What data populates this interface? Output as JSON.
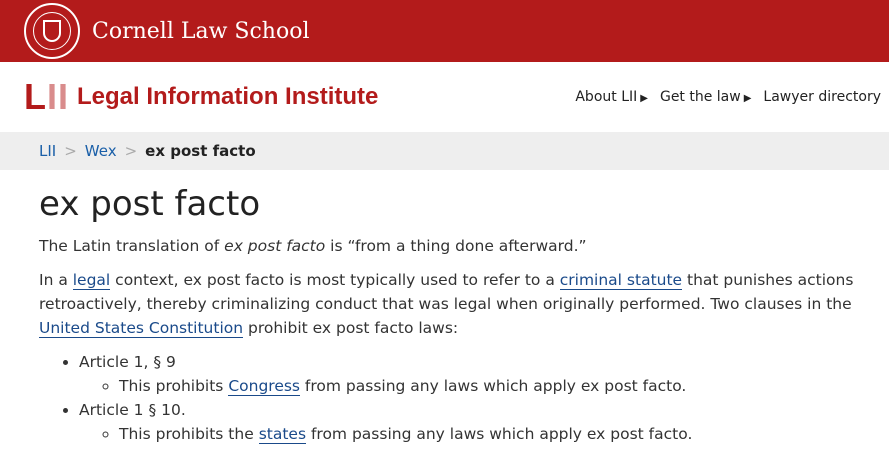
{
  "header": {
    "school": "Cornell Law School",
    "logo": "LII",
    "institute": "Legal Information Institute",
    "nav": [
      "About LII",
      "Get the law",
      "Lawyer directory"
    ]
  },
  "breadcrumb": [
    "LII",
    ">",
    "Wex",
    ">",
    "ex post facto"
  ],
  "title": "ex post facto",
  "p1": {
    "a": "The Latin translation of ",
    "em": "ex post facto",
    "b": " is “from a thing done afterward.”"
  },
  "p2": {
    "a": "In a ",
    "l1": "legal",
    "b": " context, ex post facto is most typically used to refer to a ",
    "l2": "criminal statute",
    "c": " that punishes actions retroactively, thereby criminalizing conduct that was legal when originally performed. Two clauses in the ",
    "l3": "United States Constitution",
    "d": " prohibit ex post facto laws:"
  },
  "list": [
    {
      "item": "Article 1, § 9",
      "sub": {
        "a": "This prohibits ",
        "link": "Congress",
        "b": " from passing any laws which apply ex post facto."
      }
    },
    {
      "item": "Article 1 § 10.",
      "sub": {
        "a": "This prohibits the ",
        "link": "states",
        "b": " from passing any laws which apply ex post facto."
      }
    }
  ]
}
